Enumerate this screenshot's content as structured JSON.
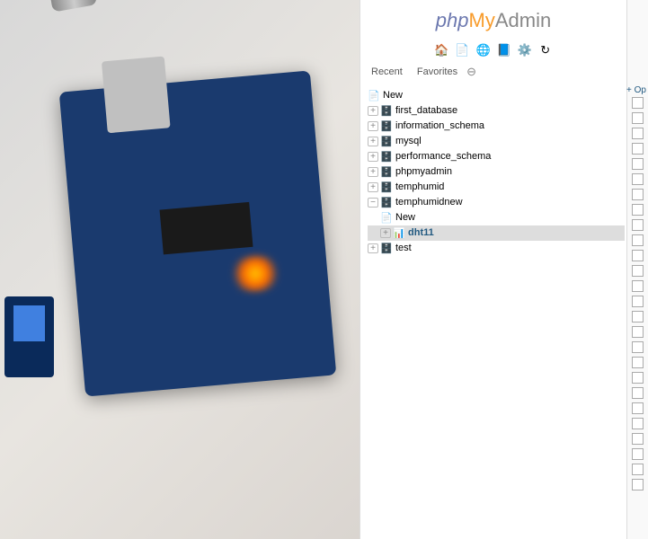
{
  "logo": {
    "part1": "php",
    "part2": "My",
    "part3": "Admin"
  },
  "tabs": {
    "recent": "Recent",
    "favorites": "Favorites"
  },
  "rightStrip": {
    "options": "+ Op"
  },
  "tree": {
    "newTop": "New",
    "databases": [
      {
        "name": "first_database"
      },
      {
        "name": "information_schema"
      },
      {
        "name": "mysql"
      },
      {
        "name": "performance_schema"
      },
      {
        "name": "phpmyadmin"
      },
      {
        "name": "temphumid"
      },
      {
        "name": "temphumidnew",
        "expanded": true,
        "children": {
          "new": "New",
          "tables": [
            "dht11"
          ]
        }
      },
      {
        "name": "test"
      }
    ]
  }
}
